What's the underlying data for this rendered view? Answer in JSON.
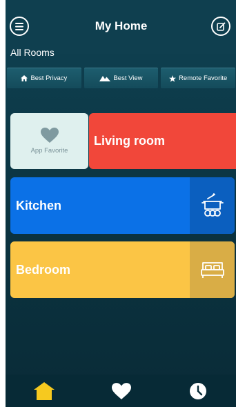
{
  "header": {
    "title": "My Home",
    "menu_icon": "menu-icon",
    "edit_icon": "edit-icon"
  },
  "section_label": "All Rooms",
  "filters": [
    {
      "label": "Best Privacy",
      "icon": "home-icon"
    },
    {
      "label": "Best View",
      "icon": "mountain-icon"
    },
    {
      "label": "Remote Favorite",
      "icon": "star-icon"
    }
  ],
  "app_favorite": {
    "label": "App Favorite",
    "icon": "heart-icon"
  },
  "rooms": [
    {
      "name": "Living room",
      "color": "#f1473a"
    },
    {
      "name": "Kitchen",
      "color": "#0b71e7",
      "icon": "cooking-pot-icon"
    },
    {
      "name": "Bedroom",
      "color": "#fbc545",
      "icon": "bed-icon"
    }
  ],
  "tabbar": [
    {
      "icon": "home-icon",
      "active": true,
      "color": "#f6c91f"
    },
    {
      "icon": "heart-icon",
      "active": false,
      "color": "#ffffff"
    },
    {
      "icon": "clock-icon",
      "active": false,
      "color": "#ffffff"
    }
  ]
}
